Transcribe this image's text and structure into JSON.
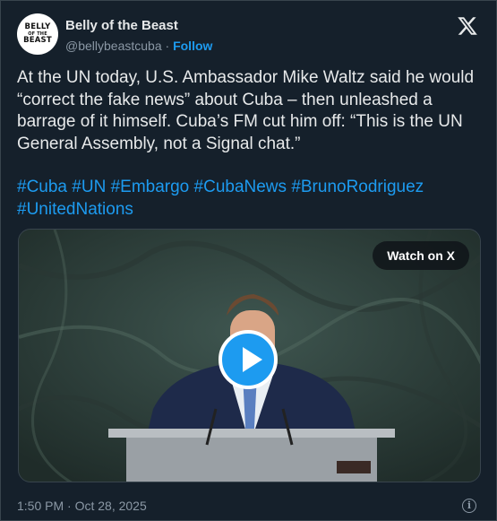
{
  "author": {
    "avatar_line1": "BELLY",
    "avatar_line2": "OF THE",
    "avatar_line3": "BEAST",
    "name": "Belly of the Beast",
    "handle": "@bellybeastcuba",
    "separator": "·",
    "follow_label": "Follow"
  },
  "tweet": {
    "text": "At the UN today, U.S. Ambassador Mike Waltz said he would “correct the fake news” about Cuba – then unleashed a barrage of it himself. Cuba’s FM cut him off: “This is the UN General Assembly, not a Signal chat.”",
    "hashtags": [
      "#Cuba",
      "#UN",
      "#Embargo",
      "#CubaNews",
      "#BrunoRodriguez",
      "#UnitedNations"
    ]
  },
  "media": {
    "watch_label": "Watch on X",
    "play_icon": "play-icon"
  },
  "footer": {
    "timestamp": "1:50 PM · Oct 28, 2025",
    "info_icon": "info-icon"
  },
  "colors": {
    "background": "#15202b",
    "accent": "#1d9bf0",
    "muted": "#8b98a5"
  }
}
